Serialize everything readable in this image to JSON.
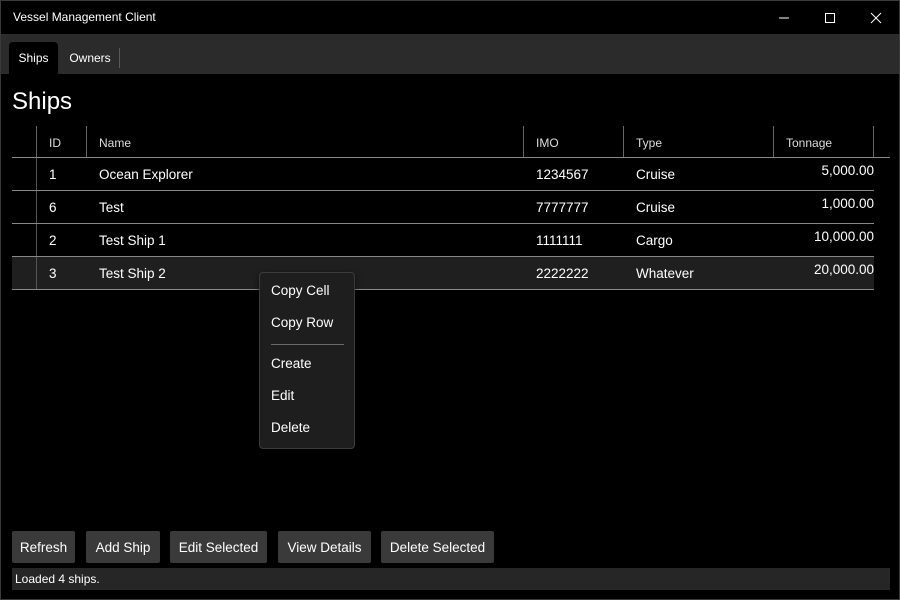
{
  "window": {
    "title": "Vessel Management Client"
  },
  "tabs": [
    {
      "label": "Ships"
    },
    {
      "label": "Owners"
    }
  ],
  "page": {
    "title": "Ships"
  },
  "grid": {
    "columns": [
      "ID",
      "Name",
      "IMO",
      "Type",
      "Tonnage"
    ],
    "rows": [
      {
        "id": "1",
        "name": "Ocean Explorer",
        "imo": "1234567",
        "type": "Cruise",
        "tonnage": "5,000.00"
      },
      {
        "id": "6",
        "name": "Test",
        "imo": "7777777",
        "type": "Cruise",
        "tonnage": "1,000.00"
      },
      {
        "id": "2",
        "name": "Test Ship 1",
        "imo": "1111111",
        "type": "Cargo",
        "tonnage": "10,000.00"
      },
      {
        "id": "3",
        "name": "Test Ship 2",
        "imo": "2222222",
        "type": "Whatever",
        "tonnage": "20,000.00"
      }
    ]
  },
  "context_menu": {
    "items": [
      "Copy Cell",
      "Copy Row",
      "Create",
      "Edit",
      "Delete"
    ]
  },
  "buttons": {
    "refresh": "Refresh",
    "add": "Add Ship",
    "edit": "Edit Selected",
    "view": "View Details",
    "delete": "Delete Selected"
  },
  "status": {
    "text": "Loaded 4 ships."
  },
  "icons": {
    "minimize": "minimize-icon",
    "maximize": "maximize-icon",
    "close": "close-icon"
  },
  "colors": {
    "background": "#000000",
    "tabstrip": "#2b2b2b",
    "button": "#3a3a3a",
    "selected_row": "#1f1f1f"
  }
}
